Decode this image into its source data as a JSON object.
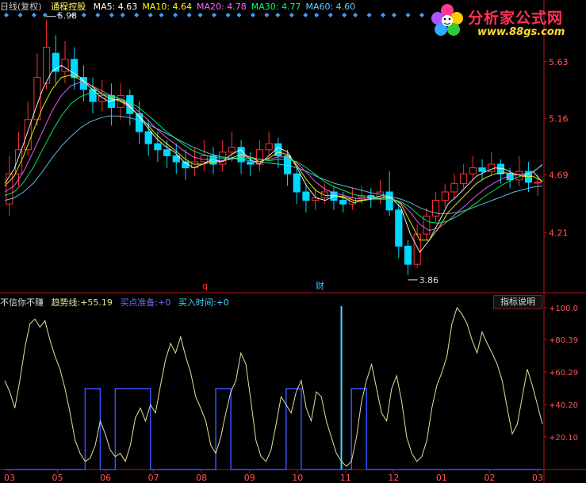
{
  "header": {
    "period": "日线(复权)",
    "stock_name": "通程控股",
    "ma": [
      {
        "label": "MA5:",
        "value": "4.63",
        "color": "#ffffff"
      },
      {
        "label": "MA10:",
        "value": "4.64",
        "color": "#ffff00"
      },
      {
        "label": "MA20:",
        "value": "4.78",
        "color": "#ff66ff"
      },
      {
        "label": "MA30:",
        "value": "4.77",
        "color": "#00ff66"
      },
      {
        "label": "MA60:",
        "value": "4.60",
        "color": "#66ccff"
      }
    ]
  },
  "logo": {
    "title": "分析家公式网",
    "url": "www.88gs.com"
  },
  "indicator": {
    "name": "不信你不赚",
    "trend_label": "趋势线:",
    "trend_value": "+55.19",
    "buy_prep_label": "买点准备:",
    "buy_prep_value": "+0",
    "buy_time_label": "买入时间:",
    "buy_time_value": "+0",
    "help_button": "指标说明"
  },
  "markers": {
    "event_q": "q",
    "event_cai": "财"
  },
  "colors": {
    "up": "#ff3030",
    "down": "#00d8ff",
    "axis": "#b01818",
    "trend": "#e6e09a",
    "signal": "#3850ff",
    "spike": "#40d8ff"
  },
  "chart_data": [
    {
      "type": "candlestick",
      "title": "通程控股 日线(复权)",
      "y_ticks": [
        "5.63",
        "5.16",
        "4.69",
        "4.21"
      ],
      "ylim": [
        3.8,
        6.05
      ],
      "annotations": {
        "high": "5.98",
        "low": "3.86"
      },
      "series": [
        {
          "name": "MA5",
          "values": [
            4.62,
            4.74,
            4.95,
            5.18,
            5.4,
            5.55,
            5.6,
            5.55,
            5.5,
            5.42,
            5.35,
            5.3,
            5.32,
            5.28,
            5.2,
            5.1,
            5.0,
            4.93,
            4.88,
            4.8,
            4.75,
            4.78,
            4.82,
            4.8,
            4.86,
            4.9,
            4.82,
            4.78,
            4.85,
            4.92,
            4.88,
            4.75,
            4.6,
            4.5,
            4.48,
            4.52,
            4.5,
            4.46,
            4.48,
            4.5,
            4.52,
            4.5,
            4.42,
            4.2,
            4.05,
            4.15,
            4.3,
            4.45,
            4.52,
            4.6,
            4.68,
            4.72,
            4.75,
            4.74,
            4.7,
            4.68,
            4.72,
            4.63
          ]
        },
        {
          "name": "MA10",
          "values": [
            4.6,
            4.68,
            4.85,
            5.05,
            5.25,
            5.4,
            5.5,
            5.52,
            5.48,
            5.44,
            5.38,
            5.33,
            5.31,
            5.27,
            5.2,
            5.12,
            5.03,
            4.96,
            4.9,
            4.83,
            4.78,
            4.78,
            4.8,
            4.8,
            4.83,
            4.86,
            4.84,
            4.8,
            4.83,
            4.88,
            4.86,
            4.77,
            4.65,
            4.56,
            4.52,
            4.52,
            4.51,
            4.48,
            4.48,
            4.49,
            4.5,
            4.5,
            4.45,
            4.3,
            4.15,
            4.15,
            4.25,
            4.38,
            4.46,
            4.54,
            4.62,
            4.67,
            4.7,
            4.71,
            4.7,
            4.68,
            4.68,
            4.64
          ]
        },
        {
          "name": "MA20",
          "values": [
            4.55,
            4.6,
            4.72,
            4.88,
            5.05,
            5.22,
            5.35,
            5.43,
            5.46,
            5.44,
            5.4,
            5.36,
            5.33,
            5.29,
            5.23,
            5.16,
            5.08,
            5.01,
            4.95,
            4.89,
            4.84,
            4.82,
            4.82,
            4.81,
            4.82,
            4.84,
            4.84,
            4.82,
            4.82,
            4.84,
            4.84,
            4.79,
            4.71,
            4.63,
            4.57,
            4.54,
            4.52,
            4.5,
            4.49,
            4.49,
            4.49,
            4.49,
            4.46,
            4.38,
            4.28,
            4.23,
            4.25,
            4.31,
            4.38,
            4.45,
            4.52,
            4.58,
            4.63,
            4.67,
            4.69,
            4.7,
            4.71,
            4.78
          ]
        },
        {
          "name": "MA30",
          "values": [
            4.52,
            4.55,
            4.63,
            4.75,
            4.9,
            5.05,
            5.18,
            5.28,
            5.34,
            5.37,
            5.37,
            5.35,
            5.33,
            5.3,
            5.26,
            5.2,
            5.13,
            5.06,
            5.0,
            4.94,
            4.89,
            4.86,
            4.84,
            4.83,
            4.83,
            4.83,
            4.83,
            4.82,
            4.81,
            4.82,
            4.82,
            4.8,
            4.75,
            4.69,
            4.63,
            4.59,
            4.56,
            4.53,
            4.51,
            4.5,
            4.49,
            4.49,
            4.47,
            4.42,
            4.35,
            4.3,
            4.29,
            4.31,
            4.35,
            4.4,
            4.46,
            4.52,
            4.57,
            4.62,
            4.66,
            4.69,
            4.72,
            4.77
          ]
        },
        {
          "name": "MA60",
          "values": [
            4.48,
            4.5,
            4.55,
            4.62,
            4.72,
            4.83,
            4.93,
            5.01,
            5.08,
            5.13,
            5.16,
            5.18,
            5.18,
            5.17,
            5.15,
            5.12,
            5.08,
            5.04,
            5.0,
            4.96,
            4.92,
            4.89,
            4.86,
            4.84,
            4.83,
            4.82,
            4.81,
            4.8,
            4.79,
            4.78,
            4.77,
            4.75,
            4.72,
            4.68,
            4.65,
            4.62,
            4.6,
            4.58,
            4.56,
            4.54,
            4.53,
            4.51,
            4.49,
            4.46,
            4.42,
            4.39,
            4.37,
            4.37,
            4.38,
            4.4,
            4.43,
            4.46,
            4.49,
            4.52,
            4.55,
            4.57,
            4.59,
            4.6
          ]
        }
      ],
      "candles": [
        [
          4.45,
          4.7,
          4.85,
          4.35
        ],
        [
          4.7,
          4.9,
          5.05,
          4.6
        ],
        [
          4.9,
          5.15,
          5.3,
          4.85
        ],
        [
          5.15,
          5.5,
          5.7,
          5.1
        ],
        [
          5.45,
          5.75,
          5.98,
          5.4
        ],
        [
          5.7,
          5.55,
          5.85,
          5.45
        ],
        [
          5.55,
          5.65,
          5.8,
          5.45
        ],
        [
          5.65,
          5.5,
          5.75,
          5.4
        ],
        [
          5.5,
          5.4,
          5.6,
          5.3
        ],
        [
          5.4,
          5.3,
          5.5,
          5.2
        ],
        [
          5.3,
          5.35,
          5.48,
          5.22
        ],
        [
          5.35,
          5.25,
          5.45,
          5.1
        ],
        [
          5.25,
          5.35,
          5.45,
          5.15
        ],
        [
          5.35,
          5.2,
          5.4,
          5.1
        ],
        [
          5.2,
          5.05,
          5.3,
          4.95
        ],
        [
          5.05,
          4.95,
          5.15,
          4.85
        ],
        [
          4.95,
          4.9,
          5.05,
          4.8
        ],
        [
          4.9,
          4.85,
          4.98,
          4.75
        ],
        [
          4.85,
          4.8,
          4.95,
          4.7
        ],
        [
          4.8,
          4.75,
          4.9,
          4.65
        ],
        [
          4.75,
          4.8,
          4.92,
          4.68
        ],
        [
          4.8,
          4.85,
          4.98,
          4.72
        ],
        [
          4.85,
          4.78,
          4.92,
          4.7
        ],
        [
          4.78,
          4.88,
          4.98,
          4.72
        ],
        [
          4.88,
          4.92,
          5.05,
          4.8
        ],
        [
          4.92,
          4.8,
          4.98,
          4.7
        ],
        [
          4.8,
          4.78,
          4.88,
          4.68
        ],
        [
          4.78,
          4.9,
          4.98,
          4.72
        ],
        [
          4.9,
          4.95,
          5.05,
          4.85
        ],
        [
          4.95,
          4.85,
          5.0,
          4.75
        ],
        [
          4.85,
          4.7,
          4.9,
          4.6
        ],
        [
          4.7,
          4.55,
          4.75,
          4.45
        ],
        [
          4.55,
          4.48,
          4.62,
          4.38
        ],
        [
          4.48,
          4.5,
          4.58,
          4.4
        ],
        [
          4.5,
          4.55,
          4.62,
          4.45
        ],
        [
          4.55,
          4.48,
          4.6,
          4.4
        ],
        [
          4.48,
          4.45,
          4.55,
          4.38
        ],
        [
          4.45,
          4.5,
          4.58,
          4.4
        ],
        [
          4.5,
          4.52,
          4.6,
          4.45
        ],
        [
          4.52,
          4.5,
          4.58,
          4.42
        ],
        [
          4.5,
          4.55,
          4.65,
          4.45
        ],
        [
          4.55,
          4.4,
          4.72,
          4.35
        ],
        [
          4.4,
          4.1,
          4.45,
          4.0
        ],
        [
          4.1,
          3.95,
          4.15,
          3.86
        ],
        [
          3.95,
          4.2,
          4.28,
          3.92
        ],
        [
          4.2,
          4.35,
          4.42,
          4.15
        ],
        [
          4.35,
          4.48,
          4.55,
          4.3
        ],
        [
          4.48,
          4.55,
          4.62,
          4.42
        ],
        [
          4.55,
          4.62,
          4.7,
          4.5
        ],
        [
          4.62,
          4.7,
          4.78,
          4.58
        ],
        [
          4.7,
          4.75,
          4.85,
          4.65
        ],
        [
          4.75,
          4.72,
          4.82,
          4.65
        ],
        [
          4.72,
          4.78,
          4.88,
          4.68
        ],
        [
          4.78,
          4.7,
          4.82,
          4.62
        ],
        [
          4.7,
          4.65,
          4.75,
          4.58
        ],
        [
          4.65,
          4.72,
          4.85,
          4.6
        ],
        [
          4.72,
          4.63,
          4.8,
          4.55
        ],
        [
          4.63,
          4.63,
          4.7,
          4.52
        ]
      ],
      "x_labels": [
        "03",
        "05",
        "06",
        "07",
        "08",
        "09",
        "10",
        "11",
        "12",
        "01",
        "02",
        "03"
      ]
    },
    {
      "type": "line",
      "title": "不信你不赚",
      "y_ticks": [
        "+100.0",
        "+80.39",
        "+60.29",
        "+40.20",
        "+20.10"
      ],
      "ylim": [
        0,
        100
      ],
      "x_labels": [
        "03",
        "05",
        "06",
        "07",
        "08",
        "09",
        "10",
        "11",
        "12",
        "01",
        "02",
        "03"
      ],
      "series": [
        {
          "name": "趋势线",
          "values": [
            55,
            48,
            38,
            55,
            75,
            90,
            93,
            88,
            92,
            80,
            70,
            62,
            50,
            35,
            18,
            10,
            5,
            7,
            15,
            30,
            22,
            12,
            8,
            10,
            5,
            15,
            32,
            38,
            30,
            40,
            35,
            52,
            68,
            78,
            72,
            82,
            70,
            60,
            45,
            38,
            30,
            15,
            10,
            20,
            35,
            48,
            55,
            72,
            65,
            42,
            18,
            8,
            5,
            12,
            28,
            45,
            40,
            35,
            48,
            55,
            38,
            30,
            48,
            45,
            30,
            20,
            10,
            5,
            2,
            5,
            20,
            42,
            55,
            65,
            50,
            35,
            30,
            50,
            58,
            42,
            20,
            10,
            5,
            8,
            18,
            38,
            52,
            60,
            70,
            90,
            100,
            96,
            90,
            80,
            72,
            85,
            78,
            72,
            65,
            55,
            38,
            22,
            28,
            45,
            62,
            52,
            40,
            28
          ]
        },
        {
          "name": "买点准备",
          "values": [
            0,
            0,
            0,
            0,
            0,
            0,
            0,
            0,
            0,
            0,
            0,
            0,
            0,
            0,
            0,
            0,
            50,
            50,
            50,
            0,
            0,
            0,
            50,
            50,
            50,
            50,
            50,
            50,
            50,
            0,
            0,
            0,
            0,
            0,
            0,
            0,
            0,
            0,
            0,
            0,
            0,
            0,
            50,
            50,
            50,
            0,
            0,
            0,
            0,
            0,
            0,
            0,
            0,
            0,
            0,
            0,
            50,
            50,
            50,
            0,
            0,
            0,
            0,
            0,
            0,
            0,
            0,
            0,
            0,
            50,
            50,
            50,
            0,
            0,
            0,
            0,
            0,
            0,
            0,
            0,
            0,
            0,
            0,
            0,
            0,
            0,
            0,
            0,
            0,
            0,
            0,
            0,
            0,
            0,
            0,
            0,
            0,
            0,
            0,
            0,
            0,
            0,
            0,
            0,
            0,
            0,
            0,
            0
          ]
        },
        {
          "name": "买入时间",
          "spike_index": 67,
          "values": []
        }
      ]
    }
  ]
}
